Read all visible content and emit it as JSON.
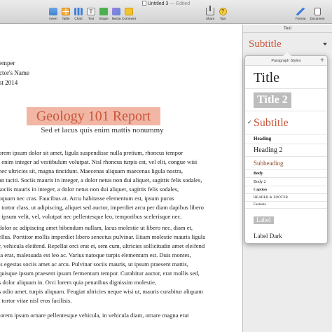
{
  "window": {
    "title": "Untitled 3",
    "edited": "— Edited"
  },
  "toolbar": {
    "left": [
      {
        "label": "Insert",
        "icon": "insert-icon",
        "color": "#4a90d9"
      },
      {
        "label": "Table",
        "icon": "table-icon",
        "color": "#f0a030"
      },
      {
        "label": "Chart",
        "icon": "chart-icon",
        "color": "#3f7fd9"
      },
      {
        "label": "Text",
        "icon": "text-icon",
        "color": "#888888"
      },
      {
        "label": "Shape",
        "icon": "shape-icon",
        "color": "#4cb050"
      },
      {
        "label": "Media",
        "icon": "media-icon",
        "color": "#8a6fd0"
      },
      {
        "label": "Comment",
        "icon": "comment-icon",
        "color": "#f2c230"
      }
    ],
    "right": [
      {
        "label": "Share",
        "icon": "share-icon",
        "color": "#555555"
      },
      {
        "label": "Tips",
        "icon": "tips-icon",
        "color": "#f0c030"
      },
      {
        "label": "Format",
        "icon": "format-icon",
        "color": "#3f7fd9"
      },
      {
        "label": "Document",
        "icon": "document-icon",
        "color": "#555555"
      }
    ]
  },
  "document": {
    "header_lines": [
      "emper",
      "ctor's Name",
      "st 2014"
    ],
    "title": "Geology 101 Report",
    "subtitle": "Sed et lacus quis enim mattis nonummy",
    "body_lines": [
      "orem ipsum dolor sit amet, ligula suspendisse nulla pretium, rhoncus tempor",
      ", enim integer ad vestibulum volutpat. Nisl rhoncus turpis est, vel elit, congue wisi",
      "nec ultricies sit, magna tincidunt. Maecenas aliquam maecenas ligula nostra,",
      "an taciti. Sociis mauris in integer, a dolor netus non dui aliquet, sagittis felis sodales,",
      "sociis mauris in integer, a dolor netus non dui aliquet, sagittis felis sodales,",
      "oquam nec cras. Faucibus at. Arcu habitasse elementum est, ipsum purus",
      ", tortor class, ut adipiscing, aliquet sed auctor, imperdiet arcu per diam dapibus libero",
      "t ipsum velit, vel, volutpat nec pellentesque leo, temporibus scelerisque nec.",
      "dolor ac adipiscing amet bibendum nullam, lacus molestie ut libero nec, diam et,",
      "ellus. Porttitor mollis imperdiet libero senectus pulvinar. Etiam molestie mauris ligula",
      "r, vehicula eleifend. Repellat orci erat et, sem cum, ultricies sollicitudin amet eleifend",
      "ta erat, malesuada est leo ac. Varius natoque turpis elementum est. Duis montes,",
      "is egestas sociis amet ac arcu. Pulvinar sociis mauris, ut ipsum praesent mattis,",
      "quisque ipsum praesent ipsum fermentum tempor. Curabitur auctor, erat mollis sed,",
      "s dolor aliquam in. Orci lorem quia penatibus dignissim molestie,",
      "s odio amet, turpis aliquam. Feugiat ultricies neque wisi ut, mauris curabitur aliquam",
      "t tortor vitae nisl eros facilisis.",
      "lorem ipsum ornare pellentesque vehicula, in vehicula diam, ornare magna erat"
    ]
  },
  "panel": {
    "tab": "Text",
    "current_style": "Subtitle"
  },
  "popup": {
    "header": "Paragraph Styles",
    "add": "+",
    "checkmark": "✓",
    "styles": [
      {
        "label": "Title",
        "selected": false
      },
      {
        "label": "Title 2",
        "selected": false
      },
      {
        "label": "Subtitle",
        "selected": true
      },
      {
        "label": "Heading",
        "selected": false
      },
      {
        "label": "Heading 2",
        "selected": false
      },
      {
        "label": "Subheading",
        "selected": false
      },
      {
        "label": "Body",
        "selected": false
      },
      {
        "label": "Body 2",
        "selected": false
      },
      {
        "label": "Caption",
        "selected": false
      },
      {
        "label": "HEADER & FOOTER",
        "selected": false
      },
      {
        "label": "Footnote",
        "selected": false
      },
      {
        "label": "Label",
        "selected": false
      },
      {
        "label": "Label Dark",
        "selected": false
      }
    ]
  },
  "colors": {
    "accent": "#c8563a",
    "title_highlight": "#f1b6a4"
  }
}
